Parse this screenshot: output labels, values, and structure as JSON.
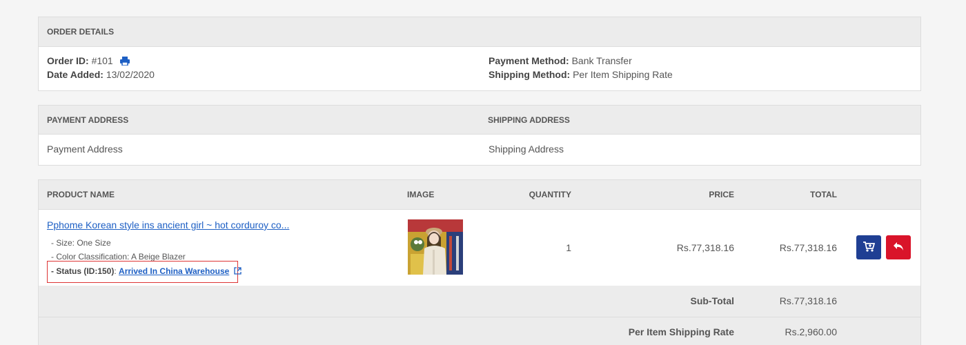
{
  "order_details": {
    "header": "ORDER DETAILS",
    "order_id_label": "Order ID:",
    "order_id": "#101",
    "date_added_label": "Date Added:",
    "date_added": "13/02/2020",
    "payment_method_label": "Payment Method:",
    "payment_method": "Bank Transfer",
    "shipping_method_label": "Shipping Method:",
    "shipping_method": "Per Item Shipping Rate"
  },
  "addresses": {
    "payment_header": "PAYMENT ADDRESS",
    "shipping_header": "SHIPPING ADDRESS",
    "payment_address": "Payment Address",
    "shipping_address": "Shipping Address"
  },
  "products": {
    "columns": {
      "name": "PRODUCT NAME",
      "image": "IMAGE",
      "quantity": "QUANTITY",
      "price": "PRICE",
      "total": "TOTAL"
    },
    "rows": [
      {
        "name": "Pphome Korean style ins ancient girl ~ hot corduroy co...",
        "option_size": "- Size: One Size",
        "option_color": "- Color Classification: A Beige Blazer",
        "status_label": "- Status (ID:150)",
        "status_sep": ":",
        "status_link": "Arrived In China Warehouse",
        "quantity": "1",
        "price": "Rs.77,318.16",
        "total": "Rs.77,318.16"
      }
    ],
    "totals": [
      {
        "label": "Sub-Total",
        "value": "Rs.77,318.16"
      },
      {
        "label": "Per Item Shipping Rate",
        "value": "Rs.2,960.00"
      }
    ]
  },
  "icons": {
    "print": "print-icon",
    "external": "external-link-icon",
    "reorder": "cart-icon",
    "return": "reply-icon"
  },
  "colors": {
    "link": "#1d5fc4",
    "reorder_button": "#1f3f93",
    "return_button": "#d9142a",
    "status_box_border": "#dd3333"
  }
}
